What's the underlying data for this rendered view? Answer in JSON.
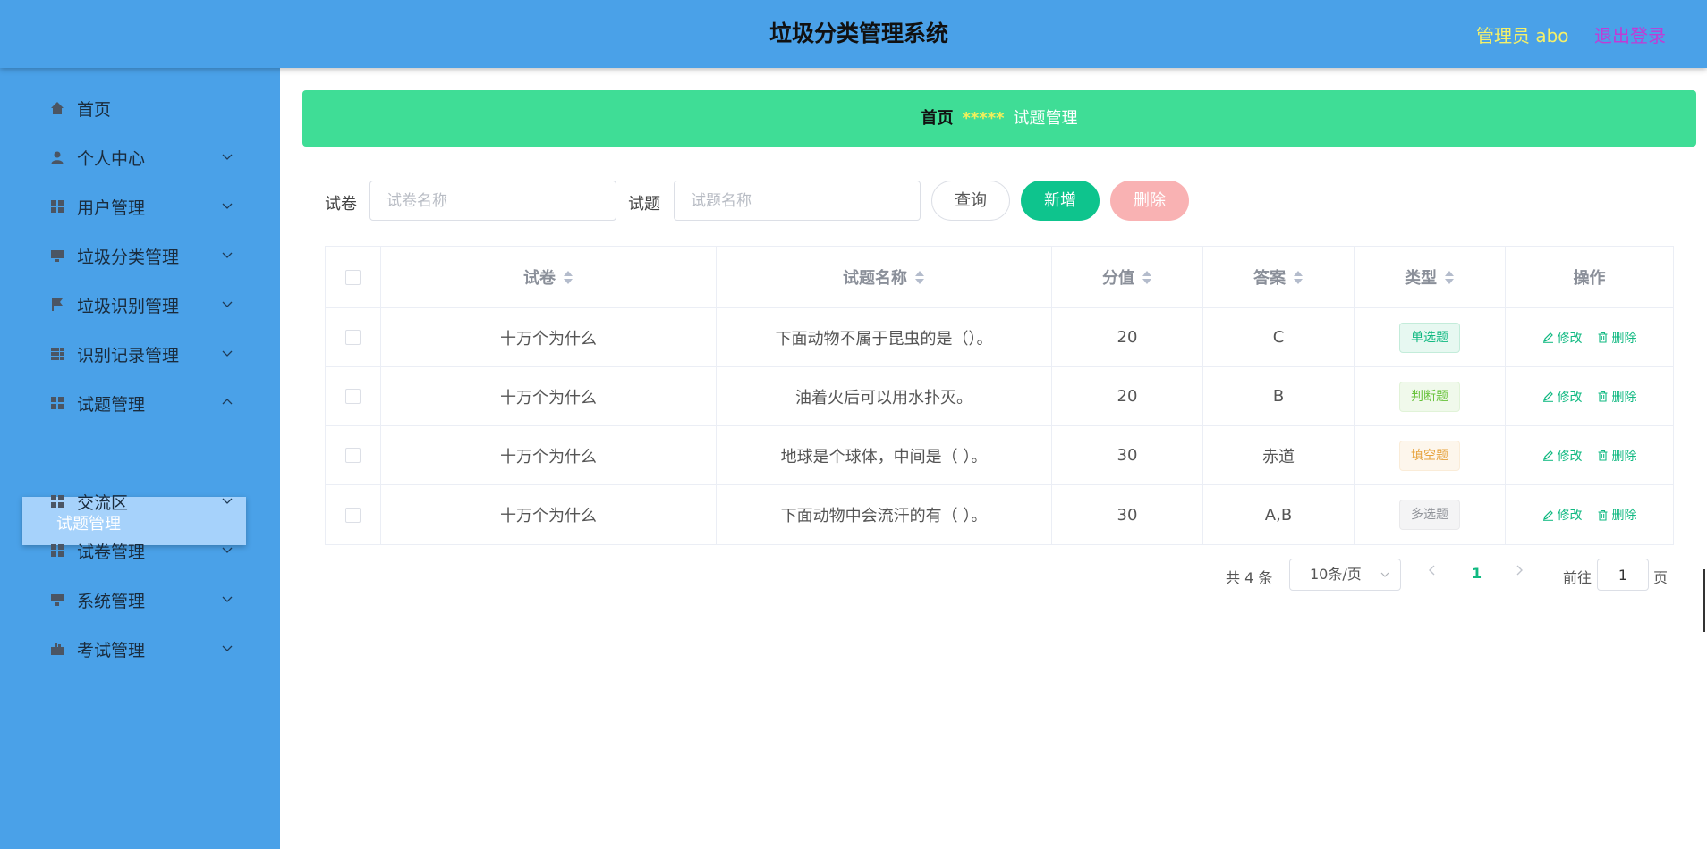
{
  "header": {
    "title": "垃圾分类管理系统",
    "admin": "管理员 abo",
    "logout": "退出登录"
  },
  "sidebar": {
    "items": [
      {
        "label": "首页",
        "icon": "home-icon"
      },
      {
        "label": "个人中心",
        "icon": "user-icon"
      },
      {
        "label": "用户管理",
        "icon": "grid-icon"
      },
      {
        "label": "垃圾分类管理",
        "icon": "monitor-icon"
      },
      {
        "label": "垃圾识别管理",
        "icon": "flag-icon"
      },
      {
        "label": "识别记录管理",
        "icon": "grid-icon"
      },
      {
        "label": "试题管理",
        "icon": "grid-icon"
      },
      {
        "label": "交流区",
        "icon": "grid-icon"
      },
      {
        "label": "试卷管理",
        "icon": "grid-icon"
      },
      {
        "label": "系统管理",
        "icon": "monitor-icon"
      },
      {
        "label": "考试管理",
        "icon": "exam-icon"
      }
    ],
    "active_sub": "试题管理"
  },
  "breadcrumb": {
    "home": "首页",
    "separator": "*****",
    "current": "试题管理"
  },
  "search": {
    "paper_label": "试卷",
    "paper_placeholder": "试卷名称",
    "question_label": "试题",
    "question_placeholder": "试题名称",
    "query_btn": "查询",
    "add_btn": "新增",
    "delete_btn": "删除"
  },
  "table": {
    "headers": [
      "试卷",
      "试题名称",
      "分值",
      "答案",
      "类型",
      "操作"
    ],
    "rows": [
      {
        "paper": "十万个为什么",
        "question": "下面动物不属于昆虫的是（）。",
        "score": "20",
        "answer": "C",
        "type": "单选题"
      },
      {
        "paper": "十万个为什么",
        "question": "油着火后可以用水扑灭。",
        "score": "20",
        "answer": "B",
        "type": "判断题"
      },
      {
        "paper": "十万个为什么",
        "question": "地球是个球体，中间是（ ）。",
        "score": "30",
        "answer": "赤道",
        "type": "填空题"
      },
      {
        "paper": "十万个为什么",
        "question": "下面动物中会流汗的有（ ）。",
        "score": "30",
        "answer": "A,B",
        "type": "多选题"
      }
    ],
    "edit_label": "修改",
    "delete_label": "删除"
  },
  "pagination": {
    "total": "共 4 条",
    "page_size": "10条/页",
    "current_page": "1",
    "goto_label": "前往",
    "goto_value": "1",
    "page_unit": "页"
  },
  "colors": {
    "sidebar": "#4aa1e8",
    "accent": "#10b981",
    "breadcrumb": "#3fdd96"
  }
}
